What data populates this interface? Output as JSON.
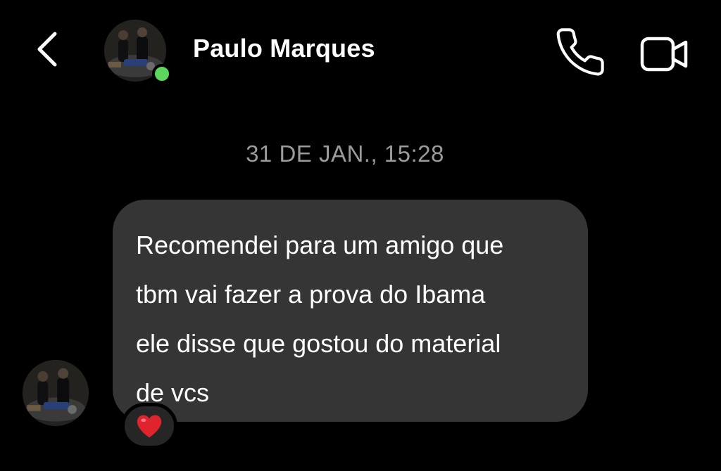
{
  "header": {
    "contact_name": "Paulo Marques",
    "online": true,
    "icons": {
      "back": "chevron-left-icon",
      "call": "phone-icon",
      "video": "video-camera-icon"
    }
  },
  "conversation": {
    "timestamp": "31 DE JAN., 15:28",
    "messages": [
      {
        "sender": "Paulo Marques",
        "lines": [
          "Recomendei para um amigo que",
          "tbm vai fazer a prova do Ibama",
          "ele disse que gostou do material",
          "de vcs"
        ],
        "reaction": "❤️"
      }
    ]
  },
  "colors": {
    "background": "#000000",
    "bubble": "#353535",
    "timestamp": "#9b9b9b",
    "online": "#5cd65c",
    "heart": "#e0242e"
  }
}
